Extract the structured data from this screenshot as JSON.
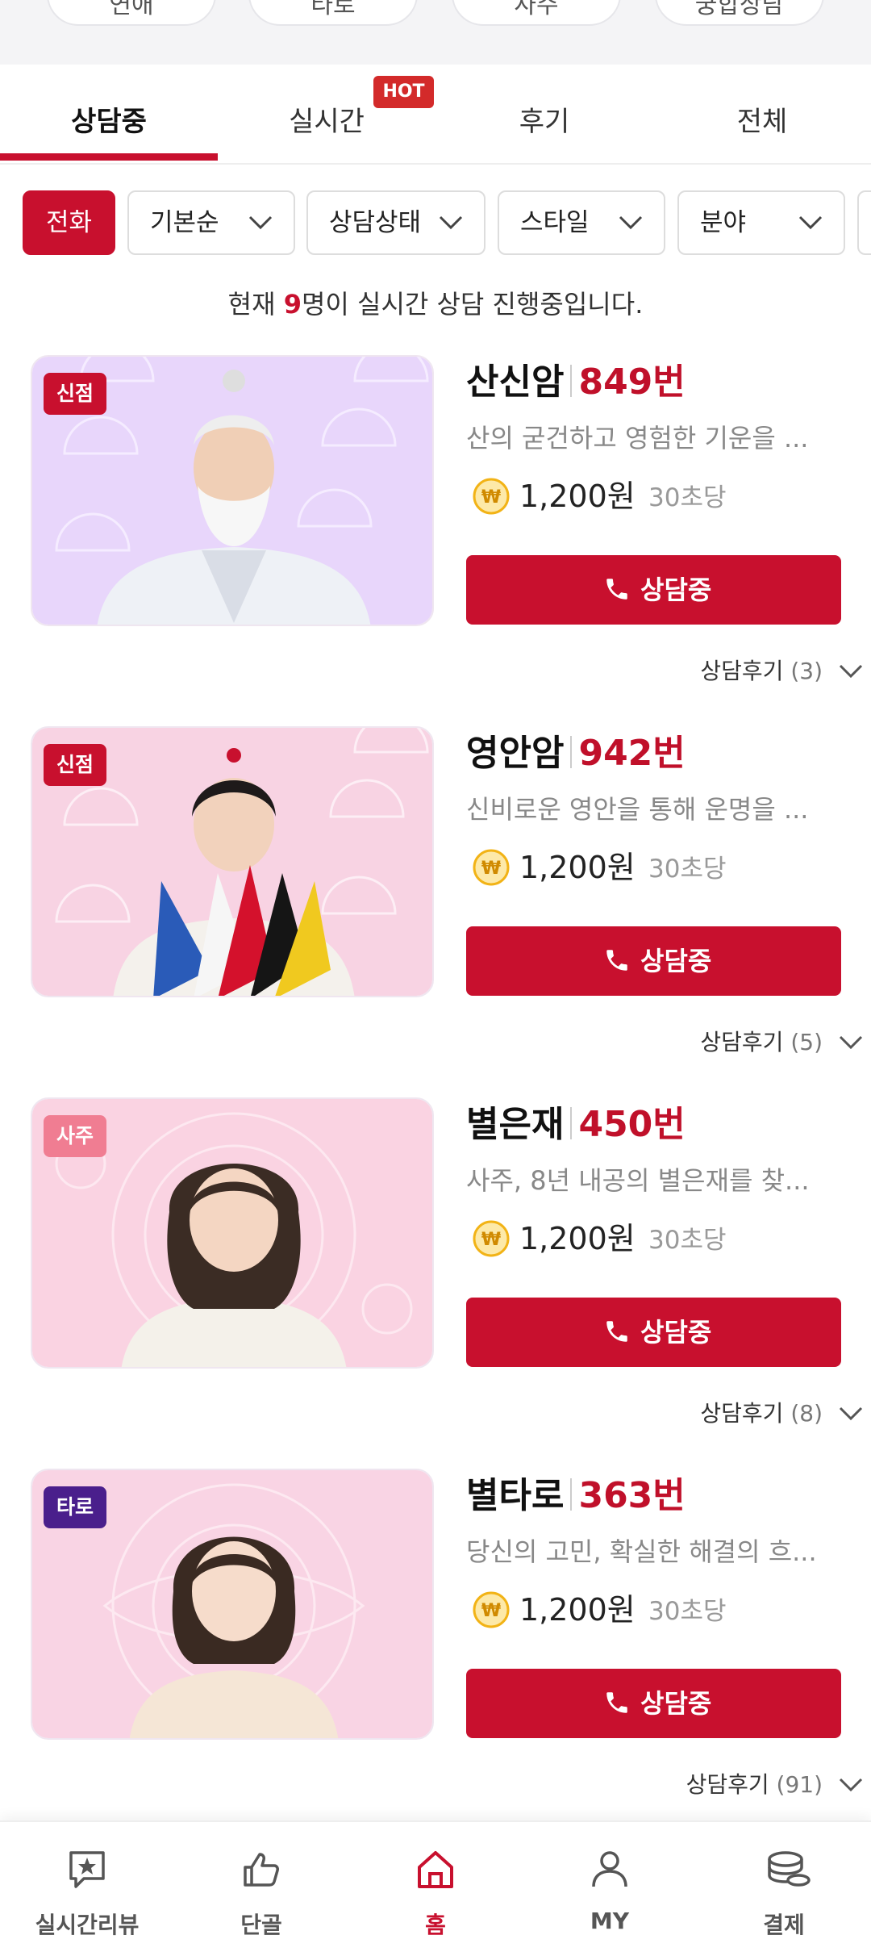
{
  "category_pills": [
    "연애",
    "타로",
    "사주",
    "궁합상담"
  ],
  "tabs": [
    {
      "label": "상담중",
      "active": true
    },
    {
      "label": "실시간",
      "active": false
    },
    {
      "label": "후기",
      "active": false
    },
    {
      "label": "전체",
      "active": false
    }
  ],
  "hot_badge": "HOT",
  "filters": {
    "phone": "전화",
    "sort": "기본순",
    "status": "상담상태",
    "style": "스타일",
    "field": "분야"
  },
  "live": {
    "prefix": "현재 ",
    "count": "9",
    "suffix": "명이 실시간 상담 진행중입니다."
  },
  "counselors": [
    {
      "badge": "신점",
      "name": "산신암",
      "code": "849번",
      "desc": "산의 굳건하고 영험한 기운을 ...",
      "price": "1,200원",
      "per": "30초당",
      "button": "상담중",
      "review_label": "상담후기",
      "review_count": "(3)"
    },
    {
      "badge": "신점",
      "name": "영안암",
      "code": "942번",
      "desc": "신비로운 영안을 통해 운명을 ...",
      "price": "1,200원",
      "per": "30초당",
      "button": "상담중",
      "review_label": "상담후기",
      "review_count": "(5)"
    },
    {
      "badge": "사주",
      "name": "별은재",
      "code": "450번",
      "desc": "사주, 8년 내공의 별은재를 찾...",
      "price": "1,200원",
      "per": "30초당",
      "button": "상담중",
      "review_label": "상담후기",
      "review_count": "(8)"
    },
    {
      "badge": "타로",
      "name": "별타로",
      "code": "363번",
      "desc": "당신의 고민, 확실한 해결의 흐...",
      "price": "1,200원",
      "per": "30초당",
      "button": "상담중",
      "review_label": "상담후기",
      "review_count": "(91)"
    }
  ],
  "bottom_nav": [
    {
      "label": "실시간리뷰",
      "icon": "star-chat-icon"
    },
    {
      "label": "단골",
      "icon": "thumbs-up-icon"
    },
    {
      "label": "홈",
      "icon": "home-icon",
      "active": true
    },
    {
      "label": "MY",
      "icon": "person-icon"
    },
    {
      "label": "결제",
      "icon": "coins-icon"
    }
  ],
  "colors": {
    "accent": "#c8102e",
    "badge_sinjeom": "#c8102e",
    "badge_saju": "#f07d92",
    "badge_taro": "#4a1f8c",
    "coin": "#f2b316"
  }
}
